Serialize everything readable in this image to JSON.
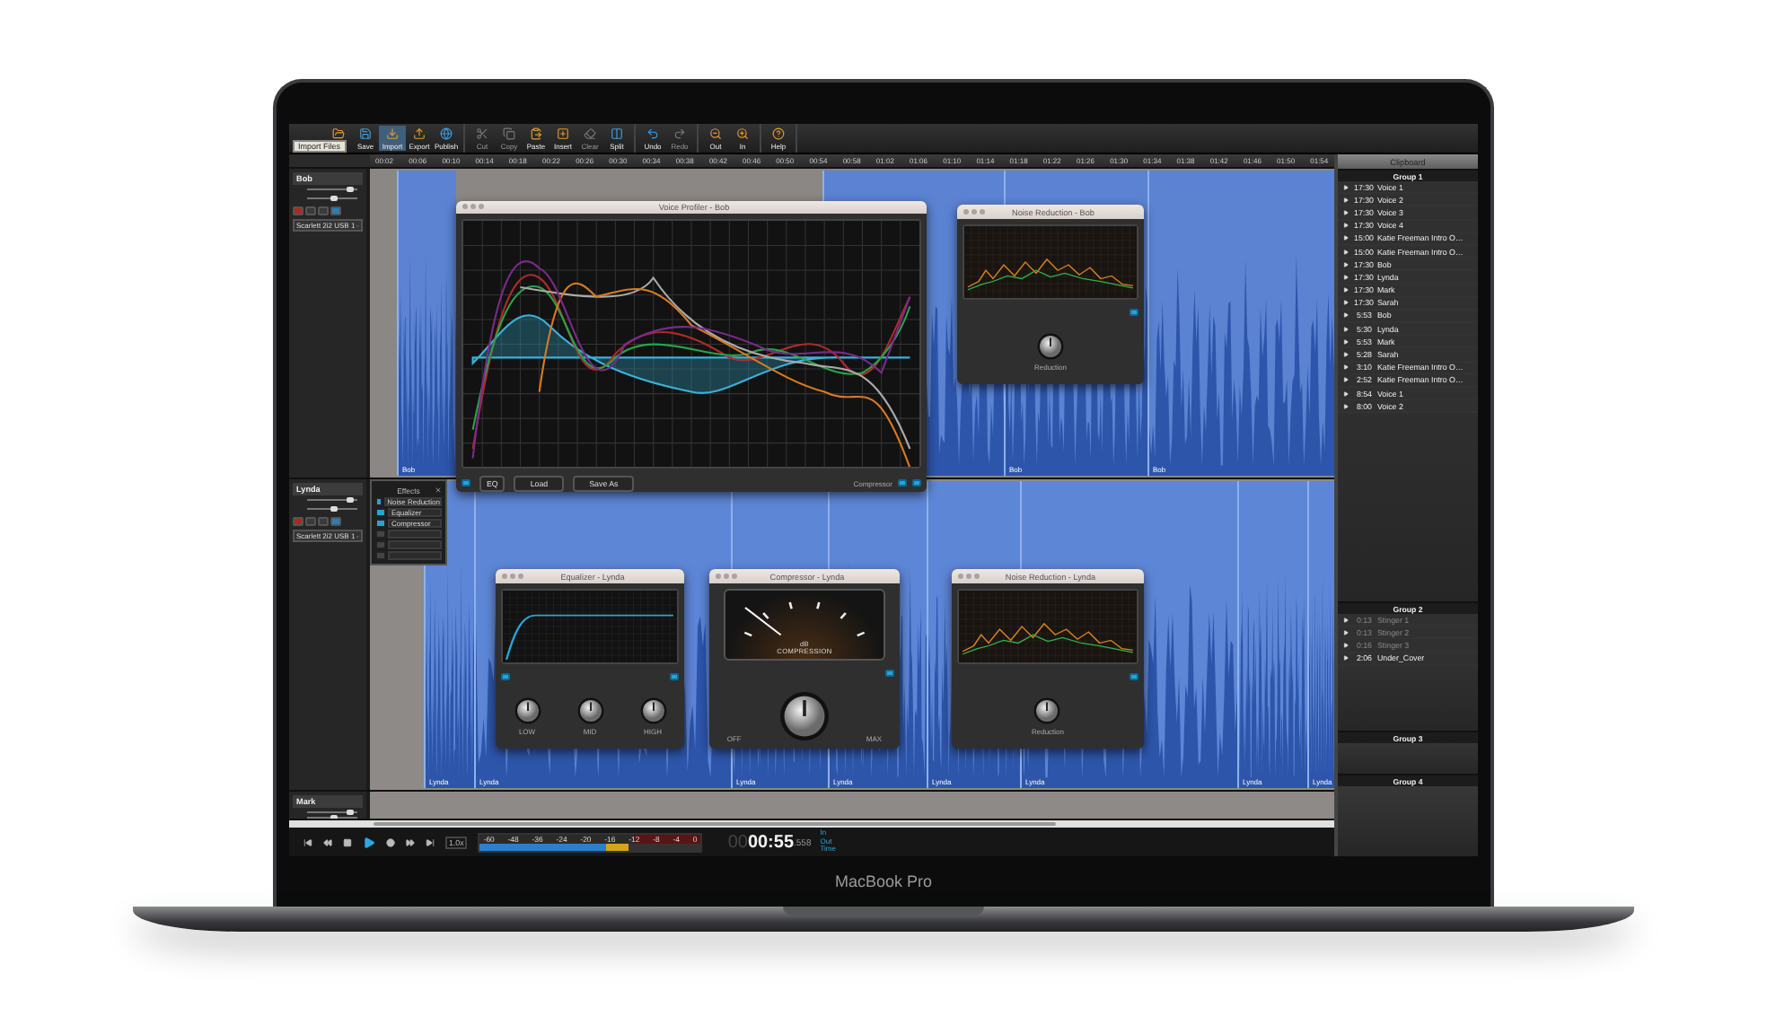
{
  "toolbar": {
    "tooltip": "Import Files",
    "groups": [
      [
        {
          "selected": false,
          "disabled": false
        },
        {
          "label": "Save",
          "selected": false,
          "disabled": false
        },
        {
          "label": "Import",
          "selected": true,
          "disabled": false
        },
        {
          "label": "Export",
          "selected": false,
          "disabled": false
        },
        {
          "label": "Publish",
          "selected": false,
          "disabled": false
        }
      ],
      [
        {
          "label": "Cut",
          "selected": false,
          "disabled": true
        },
        {
          "label": "Copy",
          "selected": false,
          "disabled": true
        },
        {
          "label": "Paste",
          "selected": false,
          "disabled": false
        },
        {
          "label": "Insert",
          "selected": false,
          "disabled": false
        },
        {
          "label": "Clear",
          "selected": false,
          "disabled": true
        },
        {
          "label": "Split",
          "selected": false,
          "disabled": false
        }
      ],
      [
        {
          "label": "Undo",
          "selected": false,
          "disabled": false
        },
        {
          "label": "Redo",
          "selected": false,
          "disabled": true
        }
      ],
      [
        {
          "label": "Out",
          "selected": false,
          "disabled": false
        },
        {
          "label": "In",
          "selected": false,
          "disabled": false
        }
      ],
      [
        {
          "label": "Help",
          "selected": false,
          "disabled": false
        }
      ]
    ]
  },
  "ruler": {
    "ticks": [
      "00:02",
      "00:06",
      "00:10",
      "00:14",
      "00:18",
      "00:22",
      "00:26",
      "00:30",
      "00:34",
      "00:38",
      "00:42",
      "00:46",
      "00:50",
      "00:54",
      "00:58",
      "01:02",
      "01:06",
      "01:10",
      "01:14",
      "01:18",
      "01:22",
      "01:26",
      "01:30",
      "01:34",
      "01:38",
      "01:42",
      "01:46",
      "01:50",
      "01:54"
    ]
  },
  "tracks": [
    {
      "name": "Bob",
      "volume": {
        "level": 0.85
      },
      "pan": {
        "level": 0.55
      },
      "device": "Scarlett 2i2 USB 1",
      "clips": [
        "Bob",
        "Bob",
        "Bob"
      ]
    },
    {
      "name": "Lynda",
      "volume": {
        "level": 0.85
      },
      "pan": {
        "level": 0.55
      },
      "device": "Scarlett 2i2 USB 1",
      "clips": [
        "Lynda",
        "Lynda",
        "Lynda",
        "Lynda",
        "Lynda",
        "Lynda",
        "Lynda",
        "Lynda"
      ]
    },
    {
      "name": "Mark",
      "volume": {
        "level": 0.85
      },
      "pan": {
        "level": 0.55
      }
    }
  ],
  "effects_popup": {
    "title": "Effects",
    "slots": [
      {
        "name": "Noise Reduction",
        "on": true
      },
      {
        "name": "Equalizer",
        "on": true
      },
      {
        "name": "Compressor",
        "on": true
      },
      {
        "on": false
      },
      {
        "on": false
      },
      {
        "on": false
      }
    ]
  },
  "windows": [
    {
      "kind": "profiler",
      "title": "Voice Profiler - Bob",
      "buttons": [
        "EQ",
        "Load",
        "Save As"
      ],
      "toggle_label": "Compressor",
      "toggles": [
        {
          "on": true
        },
        {
          "on": true
        },
        {
          "on": true
        }
      ]
    },
    {
      "kind": "noise",
      "title": "Noise Reduction - Bob",
      "knob_label": "Reduction",
      "toggles": [
        {
          "on": true
        }
      ]
    },
    {
      "kind": "eq",
      "title": "Equalizer - Lynda",
      "knobs": [
        "LOW",
        "MID",
        "HIGH"
      ],
      "toggles": [
        {
          "on": true
        },
        {
          "on": true
        }
      ]
    },
    {
      "kind": "compressor",
      "title": "Compressor - Lynda",
      "unit": "dB",
      "meter_label": "COMPRESSION",
      "min_label": "OFF",
      "max_label": "MAX",
      "toggles": [
        {
          "on": true
        }
      ]
    },
    {
      "kind": "noise",
      "title": "Noise Reduction - Lynda",
      "knob_label": "Reduction",
      "toggles": [
        {
          "on": true
        }
      ]
    }
  ],
  "transport": {
    "buttons": [
      {
        "selected": false
      },
      {
        "selected": false
      },
      {
        "selected": false
      },
      {
        "selected": true
      },
      {
        "selected": false
      },
      {
        "selected": false
      },
      {
        "selected": false
      }
    ],
    "speed": "1.0x",
    "meter": {
      "level": 0.67,
      "scale": [
        "-60",
        "-48",
        "-36",
        "-24",
        "-20",
        "-16",
        "-12",
        "-8",
        "-4",
        "0"
      ]
    },
    "time_dim": "00",
    "time": "00:55",
    "time_fraction": ".558",
    "modes": [
      "In",
      "Out",
      "Time"
    ]
  },
  "clipboard": {
    "title": "Clipboard",
    "groups": [
      {
        "name": "Group 1",
        "items": [
          {
            "time": "17:30",
            "name": "Voice 1",
            "disabled": false
          },
          {
            "time": "17:30",
            "name": "Voice 2",
            "disabled": false
          },
          {
            "time": "17:30",
            "name": "Voice 3",
            "disabled": false
          },
          {
            "time": "17:30",
            "name": "Voice 4",
            "disabled": false
          },
          {
            "time": "15:00",
            "name": "Katie Freeman Intro O…",
            "disabled": false
          },
          {
            "time": "15:00",
            "name": "Katie Freeman Intro O…",
            "disabled": false
          },
          {
            "time": "17:30",
            "name": "Bob",
            "disabled": false
          },
          {
            "time": "17:30",
            "name": "Lynda",
            "disabled": false
          },
          {
            "time": "17:30",
            "name": "Mark",
            "disabled": false
          },
          {
            "time": "17:30",
            "name": "Sarah",
            "disabled": false
          },
          {
            "time": "5:53",
            "name": "Bob",
            "disabled": false
          },
          {
            "time": "5:30",
            "name": "Lynda",
            "disabled": false
          },
          {
            "time": "5:53",
            "name": "Mark",
            "disabled": false
          },
          {
            "time": "5:28",
            "name": "Sarah",
            "disabled": false
          },
          {
            "time": "3:10",
            "name": "Katie Freeman Intro O…",
            "disabled": false
          },
          {
            "time": "2:52",
            "name": "Katie Freeman Intro O…",
            "disabled": false
          },
          {
            "time": "8:54",
            "name": "Voice 1",
            "disabled": false
          },
          {
            "time": "8:00",
            "name": "Voice 2",
            "disabled": false
          }
        ]
      },
      {
        "name": "Group 2",
        "items": [
          {
            "time": "0:13",
            "name": "Stinger 1",
            "disabled": true
          },
          {
            "time": "0:13",
            "name": "Stinger 2",
            "disabled": true
          },
          {
            "time": "0:16",
            "name": "Stinger 3",
            "disabled": true
          },
          {
            "time": "2:06",
            "name": "Under_Cover",
            "disabled": false
          }
        ]
      },
      {
        "name": "Group 3"
      },
      {
        "name": "Group 4"
      }
    ]
  },
  "laptop": {
    "label": "MacBook Pro"
  }
}
